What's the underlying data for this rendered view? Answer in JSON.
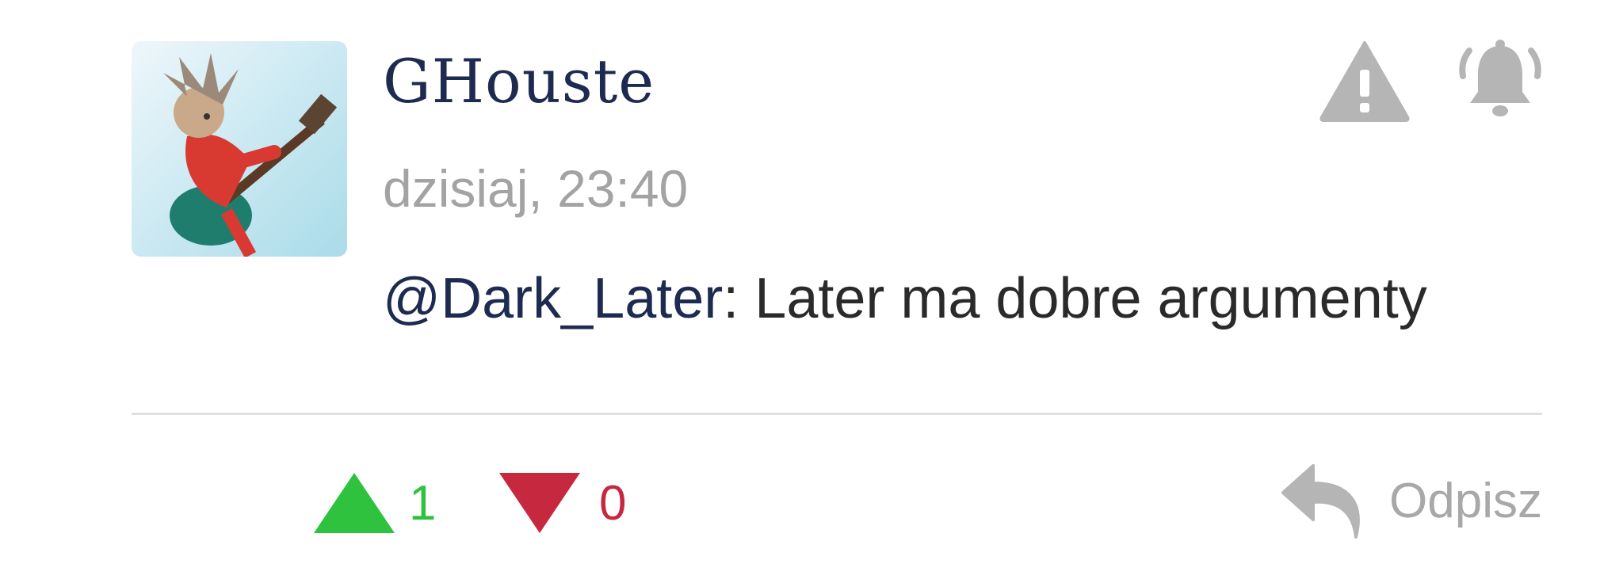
{
  "post": {
    "author": "GHouste",
    "timestamp": "dzisiaj, 23:40",
    "mention": "@Dark_Later",
    "text": ": Later ma dobre argumenty"
  },
  "actions": {
    "upvote_count": "1",
    "downvote_count": "0",
    "reply_label": "Odpisz"
  },
  "icons": {
    "report": "warning-triangle-icon",
    "subscribe": "bell-icon",
    "upvote": "triangle-up-icon",
    "downvote": "triangle-down-icon",
    "reply": "reply-arrow-icon"
  },
  "colors": {
    "author": "#1e2b50",
    "upvote": "#2fc23f",
    "downvote": "#c6283f",
    "muted": "#a3a3a3"
  }
}
